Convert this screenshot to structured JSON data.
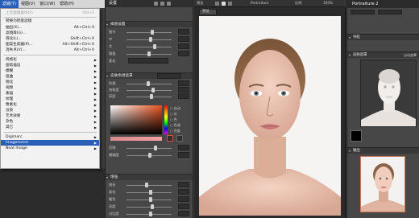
{
  "menubar": {
    "items": [
      "滤镜(T)",
      "视图(V)",
      "窗口(W)",
      "帮助(H)"
    ]
  },
  "dropdown": {
    "last_filter": {
      "label": "上次滤镜操作(F)",
      "shortcut": "Ctrl+F"
    },
    "items_top": [
      {
        "label": "转换为智能滤镜",
        "shortcut": ""
      },
      {
        "label": "抽出(X)...",
        "shortcut": "Alt+Ctrl+X"
      },
      {
        "label": "滤镜库(G)...",
        "shortcut": ""
      },
      {
        "label": "液化(L)...",
        "shortcut": "Shift+Ctrl+X"
      },
      {
        "label": "图案生成器(P)...",
        "shortcut": "Alt+Shift+Ctrl+X"
      },
      {
        "label": "消失点(V)...",
        "shortcut": "Alt+Ctrl+V"
      }
    ],
    "submenus": [
      "风格化",
      "画笔描边",
      "模糊",
      "扭曲",
      "锐化",
      "视频",
      "素描",
      "纹理",
      "像素化",
      "渲染",
      "艺术效果",
      "杂色",
      "其它"
    ],
    "plugins": [
      "Digimarc",
      "Imagenomic",
      "Neat Image"
    ],
    "highlighted": "Imagenomic"
  },
  "left_panel": {
    "header": "设置",
    "section1": "阈值设置",
    "section2": "皮肤色调遮罩",
    "section3": "增强",
    "preset_label": "预设",
    "radio_options": [
      "自动",
      "灰",
      "色",
      "色调",
      "亮度"
    ],
    "sliders1": [
      "细节",
      "中",
      "大",
      "阈值",
      "柔化"
    ],
    "sliders2": [
      "色相",
      "饱和度",
      "亮度",
      "范围",
      "模糊度"
    ],
    "sliders3": [
      "锐化",
      "柔化",
      "暖色",
      "亮度",
      "对比度"
    ],
    "accent_color": "#e7501d"
  },
  "canvas": {
    "toolbar_text": [
      "预览",
      "Portraiture",
      "比例",
      "100%"
    ],
    "tab_label": "预览"
  },
  "right_panel": {
    "title": "Portraiture 2",
    "section_nav": "导航",
    "section_mask": "皮肤遮罩",
    "section_out": "输出",
    "mask_action": "自动遮罩"
  }
}
